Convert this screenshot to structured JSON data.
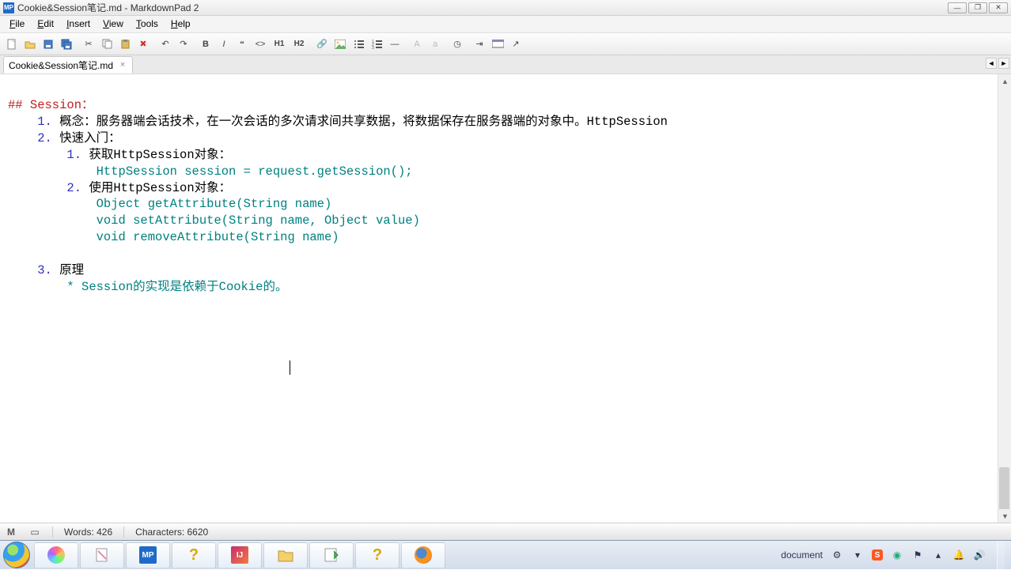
{
  "window": {
    "app_icon_text": "MP",
    "title": "Cookie&Session笔记.md - MarkdownPad 2"
  },
  "menu": {
    "file": "File",
    "edit": "Edit",
    "insert": "Insert",
    "view": "View",
    "tools": "Tools",
    "help": "Help"
  },
  "toolbar": {
    "h1": "H1",
    "h2": "H2",
    "uppercase_a": "A",
    "lowercase_a": "a"
  },
  "tabs": {
    "active": {
      "label": "Cookie&Session笔记.md"
    }
  },
  "editor": {
    "heading": "## Session：",
    "line1_num": "1. ",
    "line1_text": "概念：服务器端会话技术，在一次会话的多次请求间共享数据，将数据保存在服务器端的对象中。HttpSession",
    "line2_num": "2. ",
    "line2_text": "快速入门：",
    "line2_1_num": "1. ",
    "line2_1_text": "获取HttpSession对象：",
    "line2_1_code": "HttpSession session = request.getSession();",
    "line2_2_num": "2. ",
    "line2_2_text": "使用HttpSession对象：",
    "line2_2_code1": "Object getAttribute(String name)",
    "line2_2_code2": "void setAttribute(String name, Object value)",
    "line2_2_code3": "void removeAttribute(String name)",
    "line3_num": "3. ",
    "line3_text": "原理",
    "line3_bullet": "* Session的实现是依赖于Cookie的。"
  },
  "status": {
    "words": "Words: 426",
    "characters": "Characters: 6620"
  },
  "tray": {
    "input_method": "document"
  }
}
